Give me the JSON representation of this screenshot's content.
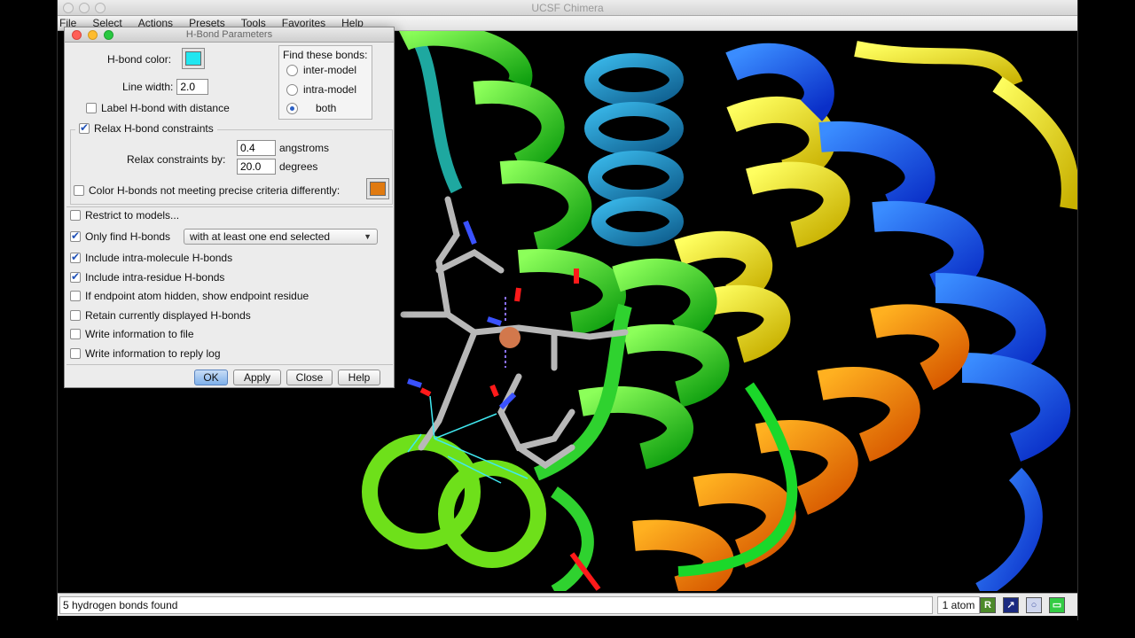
{
  "main_window": {
    "title": "UCSF Chimera",
    "menu": [
      "File",
      "Select",
      "Actions",
      "Presets",
      "Tools",
      "Favorites",
      "Help"
    ]
  },
  "dialog": {
    "title": "H-Bond Parameters",
    "hbond_color_label": "H-bond color:",
    "hbond_color": "#21e6f0",
    "line_width_label": "Line width:",
    "line_width_value": "2.0",
    "label_distance": "Label H-bond with distance",
    "find_bonds": {
      "title": "Find these bonds:",
      "options": [
        "inter-model",
        "intra-model",
        "both"
      ],
      "selected": "both"
    },
    "relax": {
      "label": "Relax H-bond constraints",
      "by_label": "Relax constraints by:",
      "distance_value": "0.4",
      "distance_unit": "angstroms",
      "angle_value": "20.0",
      "angle_unit": "degrees",
      "color_diff_label": "Color H-bonds not meeting precise criteria differently:",
      "diff_color": "#e07a10"
    },
    "restrict_models": "Restrict to models...",
    "only_find": "Only find H-bonds",
    "only_find_option": "with at least one end selected",
    "intra_molecule": "Include intra-molecule H-bonds",
    "intra_residue": "Include intra-residue H-bonds",
    "endpoint_hidden": "If endpoint atom hidden, show endpoint residue",
    "retain": "Retain currently displayed H-bonds",
    "write_file": "Write information to file",
    "write_log": "Write information to reply log",
    "buttons": {
      "ok": "OK",
      "apply": "Apply",
      "close": "Close",
      "help": "Help"
    }
  },
  "status": {
    "message": "5 hydrogen bonds found",
    "atom_count": "1 atom"
  }
}
